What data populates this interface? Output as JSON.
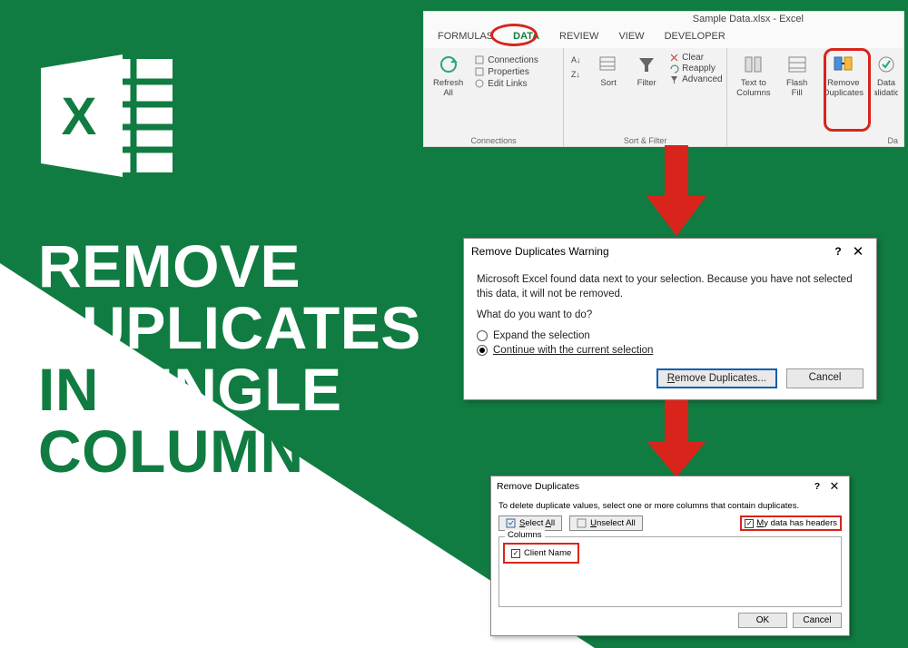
{
  "headline": {
    "w1": "REMOVE",
    "w2": "DUPLICATES",
    "w3a": "IN",
    "w3b": " SINGLE",
    "w4": "COLUMN"
  },
  "ribbon": {
    "title": "Sample Data.xlsx - Excel",
    "tabs": {
      "formulas": "FORMULAS",
      "data": "DATA",
      "review": "REVIEW",
      "view": "VIEW",
      "developer": "DEVELOPER"
    },
    "group1": {
      "refresh": "Refresh\nAll",
      "links": {
        "connections": "Connections",
        "properties": "Properties",
        "editlinks": "Edit Links"
      },
      "label": "Connections"
    },
    "group2": {
      "sortAZ": "A→Z",
      "sortZA": "Z→A",
      "sort": "Sort",
      "filter": "Filter",
      "clear": "Clear",
      "reapply": "Reapply",
      "advanced": "Advanced",
      "label": "Sort & Filter"
    },
    "group3": {
      "textToColumns": "Text to\nColumns",
      "flashFill": "Flash\nFill",
      "removeDuplicates": "Remove\nDuplicates",
      "dataValidation": "Data\nValidation",
      "label": "Da"
    }
  },
  "dialog1": {
    "title": "Remove Duplicates Warning",
    "message": "Microsoft Excel found data next to your selection. Because you have not selected this data, it will not be removed.",
    "prompt": "What do you want to do?",
    "opt1": "Expand the selection",
    "opt2": "Continue with the current selection",
    "btn_remove": "Remove Duplicates...",
    "btn_cancel": "Cancel"
  },
  "dialog2": {
    "title": "Remove Duplicates",
    "instr": "To delete duplicate values, select one or more columns that contain duplicates.",
    "selectAll": "Select All",
    "unselectAll": "Unselect All",
    "hasHeaders": "My data has headers",
    "columnsLabel": "Columns",
    "col1": "Client Name",
    "ok": "OK",
    "cancel": "Cancel"
  },
  "icons": {
    "help": "?",
    "close": "✕"
  }
}
